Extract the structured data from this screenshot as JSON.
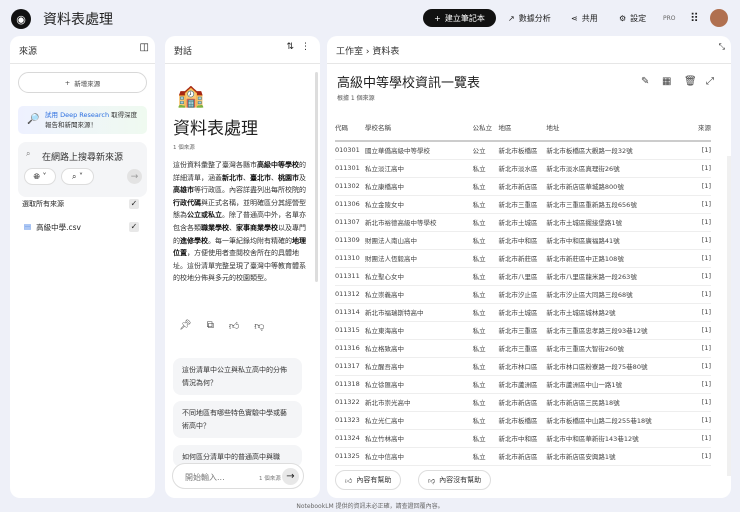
{
  "header": {
    "title": "資料表處理",
    "new_notebook": "建立筆記本",
    "analytics": "數據分析",
    "share": "共用",
    "settings": "設定",
    "pro": "PRO"
  },
  "sources": {
    "title": "來源",
    "add": "新增來源",
    "deep_link": "試用 Deep Research",
    "deep_rest": " 取得深度報告和新聞來源！",
    "search_placeholder": "在網路上搜尋新來源",
    "select_all": "選取所有來源",
    "files": [
      {
        "name": "高級中學.csv"
      }
    ]
  },
  "chat": {
    "title": "對話",
    "notebook_title": "資料表處理",
    "source_count": "1 個來源",
    "summary": [
      {
        "t": "這份資料彙整了臺灣各縣市"
      },
      {
        "t": "高級中等學校",
        "b": true
      },
      {
        "t": "的詳細清單，涵蓋"
      },
      {
        "t": "新北市",
        "b": true
      },
      {
        "t": "、"
      },
      {
        "t": "臺北市",
        "b": true
      },
      {
        "t": "、"
      },
      {
        "t": "桃園市",
        "b": true
      },
      {
        "t": "及"
      },
      {
        "t": "高雄市",
        "b": true
      },
      {
        "t": "等行政區。內容詳盡列出每所校院的"
      },
      {
        "t": "行政代碼",
        "b": true
      },
      {
        "t": "與正式名稱，並明確區分其經營型態為"
      },
      {
        "t": "公立或私立",
        "b": true
      },
      {
        "t": "。除了普通高中外，名單亦包含各類"
      },
      {
        "t": "職業學校",
        "b": true
      },
      {
        "t": "、"
      },
      {
        "t": "家事商業學校",
        "b": true
      },
      {
        "t": "以及專門的"
      },
      {
        "t": "進修學校",
        "b": true
      },
      {
        "t": "。每一筆紀錄均附有精確的"
      },
      {
        "t": "地理位置",
        "b": true
      },
      {
        "t": "，方便使用者查閱校舍所在的具體地址。這份清單完整呈現了臺灣中等教育體系的校地分佈與多元的校園類型。"
      }
    ],
    "suggestions": [
      "這份清單中公立與私立高中的分佈情況為何？",
      "不同地區有哪些特色實驗中學或藝術高中？",
      "如何區分清單中的普通高中與職"
    ],
    "input_placeholder": "開始輸入...",
    "input_sources": "1 個來源"
  },
  "studio": {
    "breadcrumb_root": "工作室",
    "breadcrumb_current": "資料表",
    "table_title": "高級中等學校資訊一覽表",
    "based_on": "根據 1 個來源",
    "columns": [
      "代碼",
      "學校名稱",
      "公私立",
      "地區",
      "地址",
      "來源"
    ],
    "rows": [
      [
        "010301",
        "國立華僑高級中等學校",
        "公立",
        "新北市板橋區",
        "新北市板橋區大觀路一段32號",
        "[1]"
      ],
      [
        "011301",
        "私立淡江高中",
        "私立",
        "新北市淡水區",
        "新北市淡水區真理街26號",
        "[1]"
      ],
      [
        "011302",
        "私立康橋高中",
        "私立",
        "新北市新店區",
        "新北市新店區華城路800號",
        "[1]"
      ],
      [
        "011306",
        "私立金陵女中",
        "私立",
        "新北市三重區",
        "新北市三重區重新路五段656號",
        "[1]"
      ],
      [
        "011307",
        "新北市裕德高級中等學校",
        "私立",
        "新北市土城區",
        "新北市土城區擺接堡路1號",
        "[1]"
      ],
      [
        "011309",
        "財團法人南山高中",
        "私立",
        "新北市中和區",
        "新北市中和區廣福路41號",
        "[1]"
      ],
      [
        "011310",
        "財團法人恆毅高中",
        "私立",
        "新北市新莊區",
        "新北市新莊區中正路108號",
        "[1]"
      ],
      [
        "011311",
        "私立聖心女中",
        "私立",
        "新北市八里區",
        "新北市八里區龍米路一段263號",
        "[1]"
      ],
      [
        "011312",
        "私立崇義高中",
        "私立",
        "新北市汐止區",
        "新北市汐止區大同路三段68號",
        "[1]"
      ],
      [
        "011314",
        "新北市福瑞斯特高中",
        "私立",
        "新北市土城區",
        "新北市土城區城林路2號",
        "[1]"
      ],
      [
        "011315",
        "私立東海高中",
        "私立",
        "新北市三重區",
        "新北市三重區忠孝路三段93巷12號",
        "[1]"
      ],
      [
        "011316",
        "私立格致高中",
        "私立",
        "新北市三重區",
        "新北市三重區大智街260號",
        "[1]"
      ],
      [
        "011317",
        "私立醒吾高中",
        "私立",
        "新北市林口區",
        "新北市林口區粉寮路一段75巷80號",
        "[1]"
      ],
      [
        "011318",
        "私立徐匯高中",
        "私立",
        "新北市蘆洲區",
        "新北市蘆洲區中山一路1號",
        "[1]"
      ],
      [
        "011322",
        "新北市崇光高中",
        "私立",
        "新北市新店區",
        "新北市新店區三民路18號",
        "[1]"
      ],
      [
        "011323",
        "私立光仁高中",
        "私立",
        "新北市板橋區",
        "新北市板橋區中山路二段255巷18號",
        "[1]"
      ],
      [
        "011324",
        "私立竹林高中",
        "私立",
        "新北市中和區",
        "新北市中和區華新街143巷12號",
        "[1]"
      ],
      [
        "011325",
        "私立中信高中",
        "私立",
        "新北市新店區",
        "新北市新店區安興路1號",
        "[1]"
      ]
    ],
    "helpful": "內容有幫助",
    "not_helpful": "內容沒有幫助"
  },
  "footer": "NotebookLM 提供的資訊未必正確，請查證回覆內容。"
}
